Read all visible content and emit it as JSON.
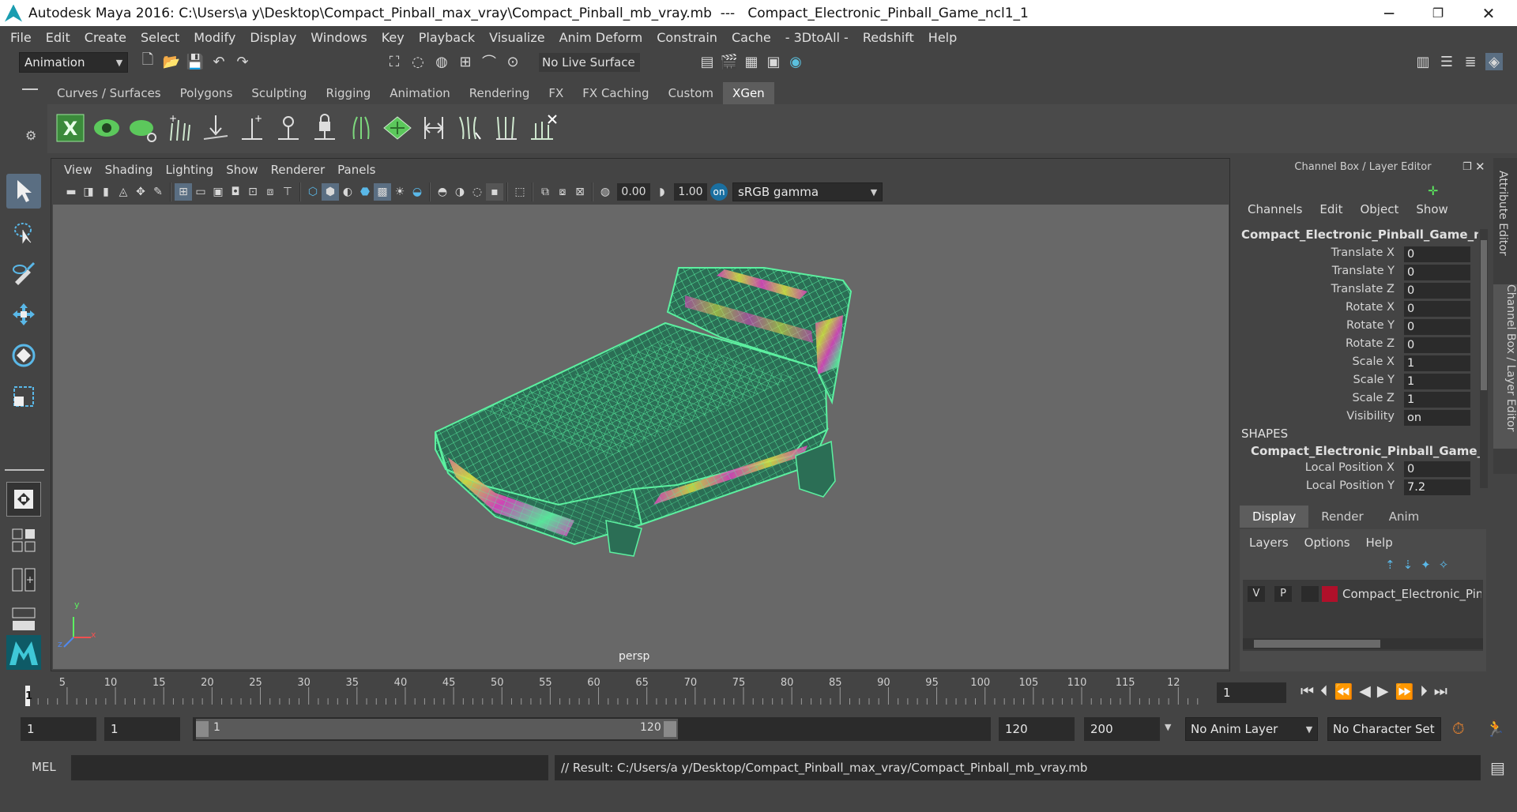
{
  "window": {
    "title": "Autodesk Maya 2016: C:\\Users\\a y\\Desktop\\Compact_Pinball_max_vray\\Compact_Pinball_mb_vray.mb  ---   Compact_Electronic_Pinball_Game_ncl1_1",
    "minimize": "─",
    "maximize": "❐",
    "close": "✕"
  },
  "menu": [
    "File",
    "Edit",
    "Create",
    "Select",
    "Modify",
    "Display",
    "Windows",
    "Key",
    "Playback",
    "Visualize",
    "Anim Deform",
    "Constrain",
    "Cache",
    "- 3DtoAll -",
    "Redshift",
    "Help"
  ],
  "status": {
    "mode": "Animation",
    "live_surface": "No Live Surface"
  },
  "shelf": {
    "tabs": [
      "Curves / Surfaces",
      "Polygons",
      "Sculpting",
      "Rigging",
      "Animation",
      "Rendering",
      "FX",
      "FX Caching",
      "Custom",
      "XGen"
    ],
    "active": "XGen"
  },
  "viewport": {
    "menu": [
      "View",
      "Shading",
      "Lighting",
      "Show",
      "Renderer",
      "Panels"
    ],
    "exposure": "0.00",
    "gamma": "1.00",
    "color_space": "sRGB gamma",
    "camera": "persp",
    "axis_x": "x",
    "axis_y": "y",
    "axis_z": "z"
  },
  "channel_box": {
    "header": "Channel Box / Layer Editor",
    "menu": [
      "Channels",
      "Edit",
      "Object",
      "Show"
    ],
    "object": "Compact_Electronic_Pinball_Game_ncl...",
    "attributes": [
      {
        "label": "Translate X",
        "value": "0"
      },
      {
        "label": "Translate Y",
        "value": "0"
      },
      {
        "label": "Translate Z",
        "value": "0"
      },
      {
        "label": "Rotate X",
        "value": "0"
      },
      {
        "label": "Rotate Y",
        "value": "0"
      },
      {
        "label": "Rotate Z",
        "value": "0"
      },
      {
        "label": "Scale X",
        "value": "1"
      },
      {
        "label": "Scale Y",
        "value": "1"
      },
      {
        "label": "Scale Z",
        "value": "1"
      },
      {
        "label": "Visibility",
        "value": "on"
      }
    ],
    "shapes_label": "SHAPES",
    "shape_name": "Compact_Electronic_Pinball_Game_n...",
    "shape_attributes": [
      {
        "label": "Local Position X",
        "value": "0"
      },
      {
        "label": "Local Position Y",
        "value": "7.2"
      }
    ]
  },
  "layer_editor": {
    "tabs": [
      "Display",
      "Render",
      "Anim"
    ],
    "active_tab": "Display",
    "menu": [
      "Layers",
      "Options",
      "Help"
    ],
    "layer": {
      "v": "V",
      "p": "P",
      "color": "#b0102a",
      "name": "Compact_Electronic_Pinb"
    }
  },
  "side_tabs": [
    "Attribute Editor",
    "Channel Box / Layer Editor"
  ],
  "timeline": {
    "ticks": [
      "1",
      "5",
      "10",
      "15",
      "20",
      "25",
      "30",
      "35",
      "40",
      "45",
      "50",
      "55",
      "60",
      "65",
      "70",
      "75",
      "80",
      "85",
      "90",
      "95",
      "100",
      "105",
      "110",
      "115",
      "12"
    ],
    "current_frame": "1"
  },
  "range": {
    "start": "1",
    "playback_start": "1",
    "slider_start": "1",
    "slider_end": "120",
    "playback_end": "120",
    "end": "200",
    "anim_layer": "No Anim Layer",
    "character_set": "No Character Set"
  },
  "command": {
    "lang": "MEL",
    "result": "// Result: C:/Users/a y/Desktop/Compact_Pinball_max_vray/Compact_Pinball_mb_vray.mb"
  },
  "colors": {
    "wire": "#5cf0a0",
    "accent_blue": "#1a9db0",
    "layer_color": "#b0102a"
  }
}
